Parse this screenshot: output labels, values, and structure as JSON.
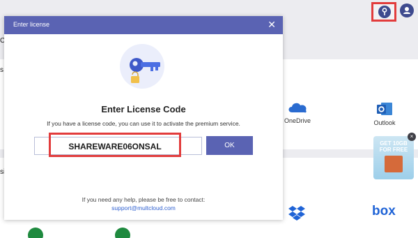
{
  "background": {
    "edge_letters": [
      "C",
      "s",
      "si"
    ],
    "services": [
      {
        "name": "OneDrive",
        "icon": "onedrive-icon",
        "color": "#2a6bd0"
      },
      {
        "name": "Outlook",
        "icon": "outlook-icon",
        "color": "#1f5eb5"
      }
    ],
    "bottom_services": [
      {
        "name": "Dropbox",
        "icon": "dropbox-icon",
        "color": "#1f63d6"
      },
      {
        "name": "box",
        "icon": "box-icon",
        "color": "#1f63d6"
      }
    ],
    "promo": {
      "text": "GET 10GB FOR FREE",
      "close": "×"
    },
    "top_icons": [
      "help-icon",
      "avatar-icon"
    ]
  },
  "modal": {
    "title": "Enter license",
    "close": "✕",
    "heading": "Enter License Code",
    "description": "If you have a license code, you can use it to activate the premium service.",
    "code_value": "SHAREWARE06ONSAL",
    "ok_label": "OK",
    "help_text": "If you need any help, please be free to contact:",
    "support_email": "support@multcloud.com"
  },
  "colors": {
    "accent": "#5a63b3",
    "highlight": "#e23c3c",
    "link": "#2d5fd0"
  }
}
